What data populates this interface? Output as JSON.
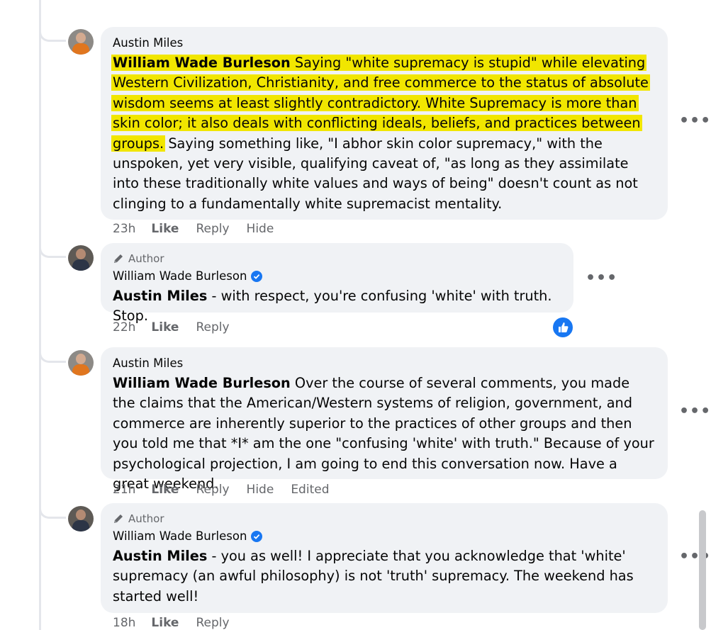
{
  "comments": [
    {
      "author": "Austin Miles",
      "author_tag": "",
      "mention": "William Wade Burleson",
      "highlighted_text": " Saying \"white supremacy is stupid\" while elevating Western Civilization, Christianity, and free commerce to the status of absolute wisdom seems at least slightly contradictory. White Supremacy is more than skin color; it also deals with conflicting ideals, beliefs, and practices between groups.",
      "text": " Saying something like, \"I abhor skin color supremacy,\" with the unspoken, yet very visible, qualifying caveat of, \"as long as they assimilate into these traditionally white values and ways of being\" doesn't count as not clinging to a fundamentally white supremacist mentality.",
      "time": "23h",
      "actions": [
        "Like",
        "Reply",
        "Hide"
      ]
    },
    {
      "author": "William Wade Burleson",
      "author_tag": "Author",
      "mention": "Austin Miles",
      "text": " - with respect, you're confusing 'white' with truth. Stop.",
      "time": "22h",
      "actions": [
        "Like",
        "Reply"
      ],
      "reaction": "like-icon"
    },
    {
      "author": "Austin Miles",
      "author_tag": "",
      "mention": "William Wade Burleson",
      "text": " Over the course of several comments, you made the claims that the American/Western systems of religion, government, and commerce are inherently superior to the practices of other groups and then you told me that *I* am the one \"confusing 'white' with truth.\" Because of your psychological projection, I am going to end this conversation now. Have a great weekend.",
      "time": "21h",
      "actions": [
        "Like",
        "Reply",
        "Hide",
        "Edited"
      ]
    },
    {
      "author": "William Wade Burleson",
      "author_tag": "Author",
      "mention": "Austin Miles",
      "text": " - you as well! I appreciate that you acknowledge that 'white' supremacy (an awful philosophy) is not 'truth' supremacy. The weekend has started well!",
      "time": "18h",
      "actions": [
        "Like",
        "Reply"
      ]
    }
  ],
  "more_label": "•••",
  "colors": {
    "highlight": "#f1e600",
    "bubble": "#f0f2f5",
    "meta": "#65676b",
    "accent": "#1877f2"
  }
}
